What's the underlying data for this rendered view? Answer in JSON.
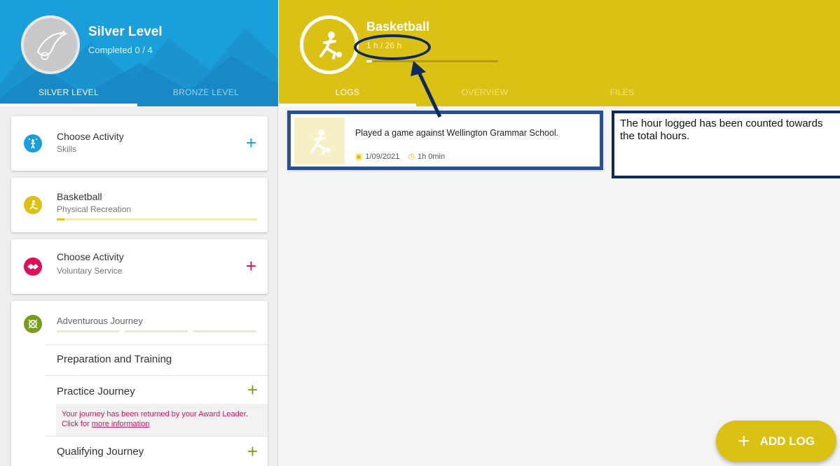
{
  "level": {
    "title": "Silver Level",
    "subtitle": "Completed 0 / 4",
    "tabs": [
      "SILVER LEVEL",
      "BRONZE LEVEL"
    ],
    "active_tab": "SILVER LEVEL"
  },
  "sections": {
    "skills": {
      "title": "Choose Activity",
      "subtitle": "Skills",
      "icon": "juggler-icon",
      "color": "#1a9fdb"
    },
    "physical": {
      "title": "Basketball",
      "subtitle": "Physical Recreation",
      "icon": "basketball-player-icon",
      "color": "#dcc115",
      "progress": 0.04
    },
    "service": {
      "title": "Choose Activity",
      "subtitle": "Voluntary Service",
      "icon": "handshake-icon",
      "color": "#e00f5a"
    },
    "journey": {
      "title": "Adventurous Journey",
      "icon": "compass-icon",
      "color": "#7a9c1d",
      "rows": [
        {
          "label": "Preparation and Training"
        },
        {
          "label": "Practice Journey"
        },
        {
          "label": "Qualifying Journey"
        }
      ],
      "note_text": "Your journey has been returned by your Award Leader. Click for",
      "note_link": "more information"
    }
  },
  "activity": {
    "title": "Basketball",
    "hours": "1 h / 26 h",
    "hours_progress": 0.038,
    "tabs": [
      "LOGS",
      "OVERVIEW",
      "FILES"
    ],
    "active_tab": "LOGS"
  },
  "logs": [
    {
      "text": "Played a game against Wellington Grammar School.",
      "date": "1/09/2021",
      "duration": "1h 0min"
    }
  ],
  "callout": {
    "text": "The hour logged has been counted towards the total hours."
  },
  "fab": {
    "label": "ADD LOG"
  },
  "colors": {
    "silver_header": "#1a9fdb",
    "activity_header": "#dcc115",
    "annotation": "#0e2a5c"
  }
}
